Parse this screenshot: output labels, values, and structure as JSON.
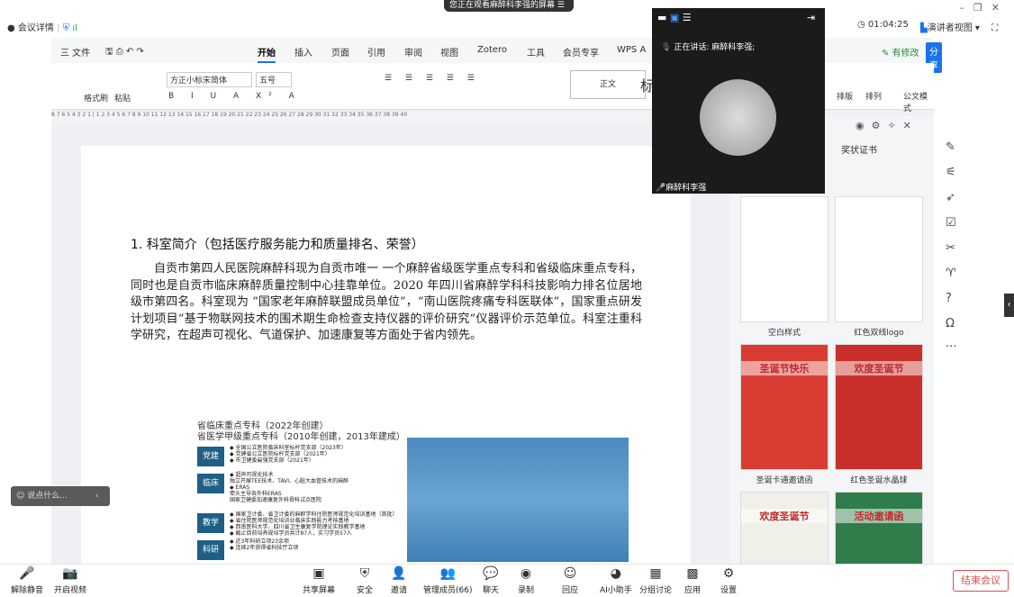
{
  "meeting": {
    "info_label": "会议详情",
    "banner": "您正在观看麻醉科李强的屏幕",
    "timer": "01:04:25",
    "view_mode": "演讲者视图"
  },
  "wps": {
    "tabs": [
      "三 文件",
      "开始",
      "插入",
      "页面",
      "引用",
      "审阅",
      "视图",
      "Zotero",
      "工具",
      "会员专享",
      "WPS A"
    ],
    "active_tab": "开始",
    "has_changes": "有修改",
    "share": "分享",
    "ribbon": {
      "format_painter": "格式刷",
      "paste": "粘贴",
      "font_name": "方正小标宋简体",
      "font_size": "五号",
      "style_body": "正文",
      "style_title": "标",
      "arrange": "排版",
      "order": "排列",
      "official": "公文模式"
    },
    "ruler": "8 7 6 5 4 3 2 1 | 1 2 3 4 5 6 7 8 9 10 11 12 13 14 15 16 17 18 19 20 21 22 23 24 25 26 27 28 29 30 31 32 33 34 35 36 37 38 39 40"
  },
  "document": {
    "heading": "1. 科室简介（包括医疗服务能力和质量排名、荣誉）",
    "paragraph": "自贡市第四人民医院麻醉科现为自贡市唯一 一个麻醉省级医学重点专科和省级临床重点专科，同时也是自贡市临床麻醉质量控制中心挂靠单位。2020 年四川省麻醉学科科技影响力排名位居地级市第四名。科室现为 “国家老年麻醉联盟成员单位”，“南山医院疼痛专科医联体”，国家重点研发计划项目“基于物联网技术的围术期生命检查支持仪器的评价研究”仪器评价示范单位。科室注重科学研究，在超声可视化、气道保护、加速康复等方面处于省内领先。",
    "image": {
      "title1": "省临床重点专科（2022年创建）",
      "title2": "省医学甲级重点专科（2010年创建，2013年建成）",
      "sections": [
        {
          "label": "党建",
          "lines": [
            "◆ 全国公立医院临床科室标杆党支部（2023年）",
            "◆ 党建省公立医院标杆党支部（2021年）",
            "◆ 市卫健委最强党支部（2021年）"
          ]
        },
        {
          "label": "临床",
          "lines": [
            "◆ 超声可视化技术",
            "独立开展TEE技术、TAVI、心脏大血管技术的麻醉",
            "◆ ERAS",
            "牵头主导各外科ERAS",
            "国家卫健委加速康复外科骨科试点医院"
          ]
        },
        {
          "label": "教学",
          "lines": [
            "◆ 国家卫计委、省卫计委的麻醉学科住院医师规范化培训基地（首批）",
            "◆ 省住院医师规范化培训业临床实践能力考核基地",
            "◆ 西南医科大学、四川省卫生康复学院理论实践教学基地",
            "◆ 截止目前培养规培学员共计87人，实习学员57人"
          ]
        },
        {
          "label": "科研",
          "lines": [
            "◆ 近3年科研立项23余项",
            "◆ 连续2年获得省科技厅立项"
          ]
        }
      ]
    }
  },
  "video": {
    "speaking": "正在讲话: 麻醉科李强;",
    "name": "麻醉科李强"
  },
  "templates": {
    "panel_title": "奖状证书",
    "items": [
      {
        "label": "空白样式",
        "style": "blank"
      },
      {
        "label": "红色双线logo",
        "style": "redline"
      },
      {
        "label": "圣诞卡通邀请函",
        "style": "xmas1",
        "text": "圣诞节快乐"
      },
      {
        "label": "红色圣诞水晶球",
        "style": "xmas2",
        "text": "欢度圣诞节"
      },
      {
        "label": "",
        "style": "xmas3",
        "text": "欢度圣诞节"
      },
      {
        "label": "",
        "style": "xmas4",
        "text": "活动邀请函"
      }
    ]
  },
  "chat": {
    "placeholder": "说点什么..."
  },
  "bottom": {
    "left": [
      {
        "label": "解除静音",
        "icon": "mic-off-icon"
      },
      {
        "label": "开启视频",
        "icon": "camera-off-icon"
      }
    ],
    "center": [
      {
        "label": "共享屏幕"
      },
      {
        "label": "安全"
      },
      {
        "label": "邀请"
      },
      {
        "label": "管理成员(66)"
      },
      {
        "label": "聊天"
      },
      {
        "label": "录制"
      },
      {
        "label": "回应"
      },
      {
        "label": "AI小助手"
      },
      {
        "label": "分组讨论"
      },
      {
        "label": "应用"
      },
      {
        "label": "设置"
      }
    ],
    "end": "结束会议"
  }
}
